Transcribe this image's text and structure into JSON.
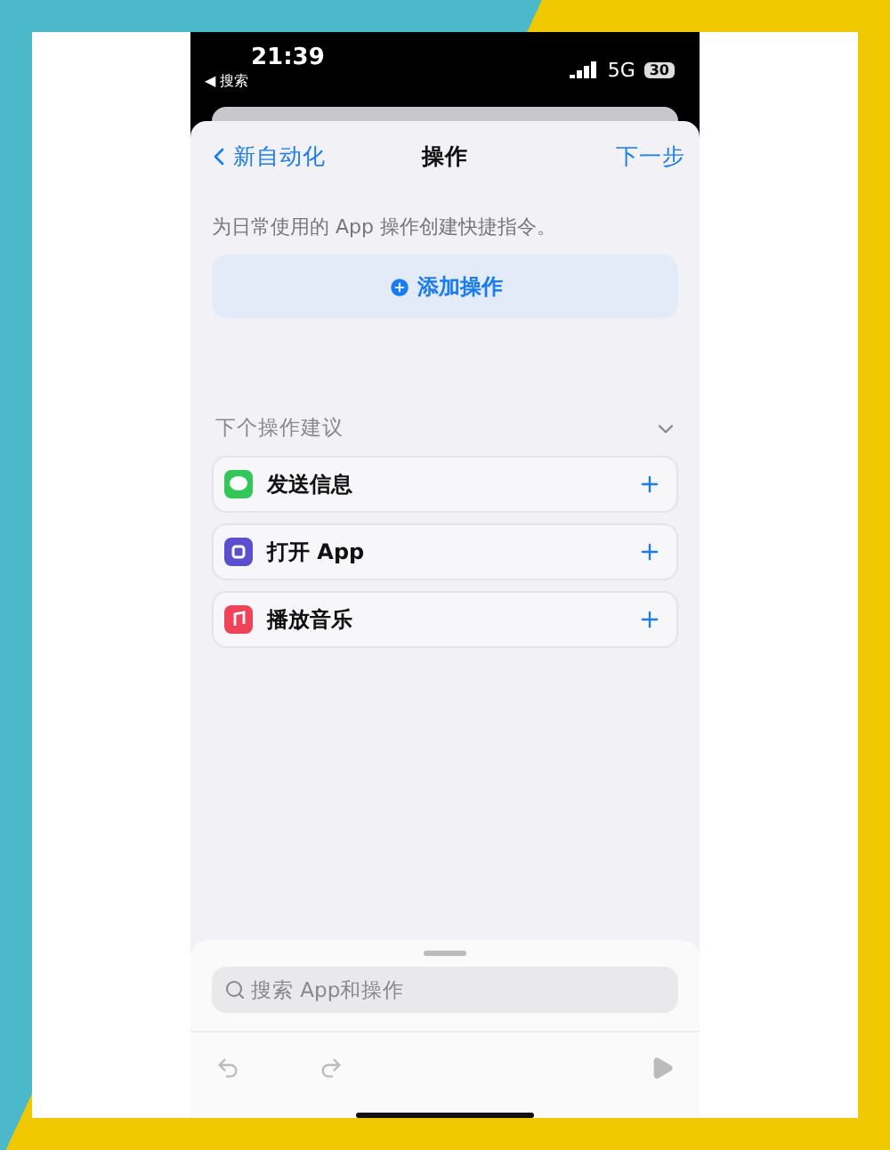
{
  "status_bar": {
    "time": "21:39",
    "back_label": "◀ 搜索",
    "network": "5G",
    "battery": "30"
  },
  "nav": {
    "back": "新自动化",
    "title": "操作",
    "next": "下一步"
  },
  "intro": "为日常使用的 App 操作创建快捷指令。",
  "add_button": "添加操作",
  "suggestions": {
    "title": "下个操作建议",
    "expanded": true,
    "items": [
      {
        "kind": "messages",
        "label": "发送信息"
      },
      {
        "kind": "app",
        "label": "打开 App"
      },
      {
        "kind": "music",
        "label": "播放音乐"
      }
    ]
  },
  "search": {
    "placeholder": "搜索 App和操作"
  }
}
